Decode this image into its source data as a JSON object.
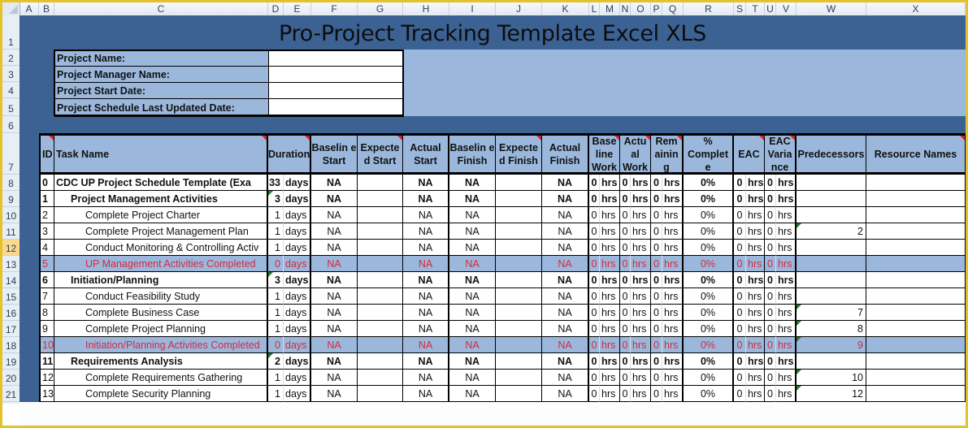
{
  "spreadsheet": {
    "column_headers": [
      "A",
      "B",
      "C",
      "D",
      "E",
      "F",
      "G",
      "H",
      "I",
      "J",
      "K",
      "L",
      "M",
      "N",
      "O",
      "P",
      "Q",
      "R",
      "S",
      "T",
      "U",
      "V",
      "W",
      "X"
    ],
    "row_headers": [
      "1",
      "2",
      "3",
      "4",
      "5",
      "6",
      "7",
      "8",
      "9",
      "10",
      "11",
      "12",
      "13",
      "14",
      "15",
      "16",
      "17",
      "18",
      "19",
      "20",
      "21"
    ],
    "selected_row": "12",
    "colors": {
      "frame": "#e2c32a",
      "dark_band": "#3b6293",
      "light_band": "#9bb8dc",
      "milestone_text": "#d42a3d",
      "note_marker": "#d1232a",
      "error_marker": "#1e7a2e"
    }
  },
  "title": "Pro-Project Tracking Template Excel XLS",
  "project_info": [
    {
      "label": "Project Name:",
      "value": ""
    },
    {
      "label": "Project Manager Name:",
      "value": ""
    },
    {
      "label": "Project Start Date:",
      "value": ""
    },
    {
      "label": "Project Schedule Last Updated Date:",
      "value": ""
    }
  ],
  "table": {
    "headers": {
      "id": "ID",
      "task_name": "Task Name",
      "duration": "Duration",
      "baseline_start": "Baselin e Start",
      "expected_start": "Expecte d Start",
      "actual_start": "Actual Start",
      "baseline_finish": "Baselin e Finish",
      "expected_finish": "Expecte d Finish",
      "actual_finish": "Actual Finish",
      "baseline_work": "Base line Work",
      "actual_work": "Actu al Work",
      "remaining": "Rem ainin g",
      "pct_complete": "% Complet e",
      "eac": "EAC",
      "eac_variance": "EAC Varia nce",
      "predecessors": "Predecessors",
      "resource_names": "Resource Names"
    },
    "rows": [
      {
        "id": "0",
        "task": "CDC UP Project Schedule Template (Exa",
        "indent": 0,
        "style": "bold",
        "dur": "33",
        "dur_unit": "days",
        "bs": "NA",
        "es": "",
        "as": "NA",
        "bf": "NA",
        "ef": "",
        "af": "NA",
        "bw": "0",
        "bw_u": "hrs",
        "aw": "0",
        "aw_u": "hrs",
        "rem": "0",
        "rem_u": "hrs",
        "pct": "0%",
        "eac": "0",
        "eac_u": "hrs",
        "var": "0",
        "var_u": "hrs",
        "pred": "",
        "res": ""
      },
      {
        "id": "1",
        "task": "Project Management Activities",
        "indent": 1,
        "style": "bold",
        "dur": "3",
        "dur_unit": "days",
        "bs": "NA",
        "es": "",
        "as": "NA",
        "bf": "NA",
        "ef": "",
        "af": "NA",
        "bw": "0",
        "bw_u": "hrs",
        "aw": "0",
        "aw_u": "hrs",
        "rem": "0",
        "rem_u": "hrs",
        "pct": "0%",
        "eac": "0",
        "eac_u": "hrs",
        "var": "0",
        "var_u": "hrs",
        "pred": "",
        "res": ""
      },
      {
        "id": "2",
        "task": "Complete Project Charter",
        "indent": 2,
        "style": "normal",
        "dur": "1",
        "dur_unit": "days",
        "bs": "NA",
        "es": "",
        "as": "NA",
        "bf": "NA",
        "ef": "",
        "af": "NA",
        "bw": "0",
        "bw_u": "hrs",
        "aw": "0",
        "aw_u": "hrs",
        "rem": "0",
        "rem_u": "hrs",
        "pct": "0%",
        "eac": "0",
        "eac_u": "hrs",
        "var": "0",
        "var_u": "hrs",
        "pred": "",
        "res": ""
      },
      {
        "id": "3",
        "task": "Complete Project Management Plan",
        "indent": 2,
        "style": "normal",
        "dur": "1",
        "dur_unit": "days",
        "bs": "NA",
        "es": "",
        "as": "NA",
        "bf": "NA",
        "ef": "",
        "af": "NA",
        "bw": "0",
        "bw_u": "hrs",
        "aw": "0",
        "aw_u": "hrs",
        "rem": "0",
        "rem_u": "hrs",
        "pct": "0%",
        "eac": "0",
        "eac_u": "hrs",
        "var": "0",
        "var_u": "hrs",
        "pred": "2",
        "res": ""
      },
      {
        "id": "4",
        "task": "Conduct Monitoring & Controlling Activ",
        "indent": 2,
        "style": "normal",
        "dur": "1",
        "dur_unit": "days",
        "bs": "NA",
        "es": "",
        "as": "NA",
        "bf": "NA",
        "ef": "",
        "af": "NA",
        "bw": "0",
        "bw_u": "hrs",
        "aw": "0",
        "aw_u": "hrs",
        "rem": "0",
        "rem_u": "hrs",
        "pct": "0%",
        "eac": "0",
        "eac_u": "hrs",
        "var": "0",
        "var_u": "hrs",
        "pred": "",
        "res": ""
      },
      {
        "id": "5",
        "task": "UP Management Activities Completed",
        "indent": 2,
        "style": "milestone",
        "dur": "0",
        "dur_unit": "days",
        "bs": "NA",
        "es": "",
        "as": "NA",
        "bf": "NA",
        "ef": "",
        "af": "NA",
        "bw": "0",
        "bw_u": "hrs",
        "aw": "0",
        "aw_u": "hrs",
        "rem": "0",
        "rem_u": "hrs",
        "pct": "0%",
        "eac": "0",
        "eac_u": "hrs",
        "var": "0",
        "var_u": "hrs",
        "pred": "",
        "res": ""
      },
      {
        "id": "6",
        "task": "Initiation/Planning",
        "indent": 1,
        "style": "bold",
        "dur": "3",
        "dur_unit": "days",
        "bs": "NA",
        "es": "",
        "as": "NA",
        "bf": "NA",
        "ef": "",
        "af": "NA",
        "bw": "0",
        "bw_u": "hrs",
        "aw": "0",
        "aw_u": "hrs",
        "rem": "0",
        "rem_u": "hrs",
        "pct": "0%",
        "eac": "0",
        "eac_u": "hrs",
        "var": "0",
        "var_u": "hrs",
        "pred": "",
        "res": ""
      },
      {
        "id": "7",
        "task": "Conduct Feasibility Study",
        "indent": 2,
        "style": "normal",
        "dur": "1",
        "dur_unit": "days",
        "bs": "NA",
        "es": "",
        "as": "NA",
        "bf": "NA",
        "ef": "",
        "af": "NA",
        "bw": "0",
        "bw_u": "hrs",
        "aw": "0",
        "aw_u": "hrs",
        "rem": "0",
        "rem_u": "hrs",
        "pct": "0%",
        "eac": "0",
        "eac_u": "hrs",
        "var": "0",
        "var_u": "hrs",
        "pred": "",
        "res": ""
      },
      {
        "id": "8",
        "task": "Complete Business Case",
        "indent": 2,
        "style": "normal",
        "dur": "1",
        "dur_unit": "days",
        "bs": "NA",
        "es": "",
        "as": "NA",
        "bf": "NA",
        "ef": "",
        "af": "NA",
        "bw": "0",
        "bw_u": "hrs",
        "aw": "0",
        "aw_u": "hrs",
        "rem": "0",
        "rem_u": "hrs",
        "pct": "0%",
        "eac": "0",
        "eac_u": "hrs",
        "var": "0",
        "var_u": "hrs",
        "pred": "7",
        "res": ""
      },
      {
        "id": "9",
        "task": "Complete Project Planning",
        "indent": 2,
        "style": "normal",
        "dur": "1",
        "dur_unit": "days",
        "bs": "NA",
        "es": "",
        "as": "NA",
        "bf": "NA",
        "ef": "",
        "af": "NA",
        "bw": "0",
        "bw_u": "hrs",
        "aw": "0",
        "aw_u": "hrs",
        "rem": "0",
        "rem_u": "hrs",
        "pct": "0%",
        "eac": "0",
        "eac_u": "hrs",
        "var": "0",
        "var_u": "hrs",
        "pred": "8",
        "res": ""
      },
      {
        "id": "10",
        "task": "Initiation/Planning Activities Completed",
        "indent": 2,
        "style": "milestone",
        "dur": "0",
        "dur_unit": "days",
        "bs": "NA",
        "es": "",
        "as": "NA",
        "bf": "NA",
        "ef": "",
        "af": "NA",
        "bw": "0",
        "bw_u": "hrs",
        "aw": "0",
        "aw_u": "hrs",
        "rem": "0",
        "rem_u": "hrs",
        "pct": "0%",
        "eac": "0",
        "eac_u": "hrs",
        "var": "0",
        "var_u": "hrs",
        "pred": "9",
        "res": ""
      },
      {
        "id": "11",
        "task": "Requirements Analysis",
        "indent": 1,
        "style": "bold",
        "dur": "2",
        "dur_unit": "days",
        "bs": "NA",
        "es": "",
        "as": "NA",
        "bf": "NA",
        "ef": "",
        "af": "NA",
        "bw": "0",
        "bw_u": "hrs",
        "aw": "0",
        "aw_u": "hrs",
        "rem": "0",
        "rem_u": "hrs",
        "pct": "0%",
        "eac": "0",
        "eac_u": "hrs",
        "var": "0",
        "var_u": "hrs",
        "pred": "",
        "res": ""
      },
      {
        "id": "12",
        "task": "Complete Requirements Gathering",
        "indent": 2,
        "style": "normal",
        "dur": "1",
        "dur_unit": "days",
        "bs": "NA",
        "es": "",
        "as": "NA",
        "bf": "NA",
        "ef": "",
        "af": "NA",
        "bw": "0",
        "bw_u": "hrs",
        "aw": "0",
        "aw_u": "hrs",
        "rem": "0",
        "rem_u": "hrs",
        "pct": "0%",
        "eac": "0",
        "eac_u": "hrs",
        "var": "0",
        "var_u": "hrs",
        "pred": "10",
        "res": ""
      },
      {
        "id": "13",
        "task": "Complete Security Planning",
        "indent": 2,
        "style": "normal",
        "dur": "1",
        "dur_unit": "days",
        "bs": "NA",
        "es": "",
        "as": "NA",
        "bf": "NA",
        "ef": "",
        "af": "NA",
        "bw": "0",
        "bw_u": "hrs",
        "aw": "0",
        "aw_u": "hrs",
        "rem": "0",
        "rem_u": "hrs",
        "pct": "0%",
        "eac": "0",
        "eac_u": "hrs",
        "var": "0",
        "var_u": "hrs",
        "pred": "12",
        "res": ""
      }
    ]
  }
}
